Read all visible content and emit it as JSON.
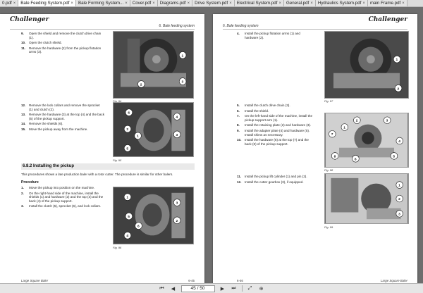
{
  "tabs": [
    {
      "label": "0.pdf",
      "active": false
    },
    {
      "label": "Bale Feeding System.pdf",
      "active": true
    },
    {
      "label": "Bale Forming System...",
      "active": false
    },
    {
      "label": "Cover.pdf",
      "active": false
    },
    {
      "label": "Diagrams.pdf",
      "active": false
    },
    {
      "label": "Drive System.pdf",
      "active": false
    },
    {
      "label": "Electrical System.pdf",
      "active": false
    },
    {
      "label": "General.pdf",
      "active": false
    },
    {
      "label": "Hydraulics System.pdf",
      "active": false
    },
    {
      "label": "main Frame.pdf",
      "active": false
    }
  ],
  "left_page": {
    "brand": "Challenger",
    "section": "6. Bale feeding system",
    "steps_top": [
      {
        "num": "9.",
        "text": "Open the shield and remove the clutch drive chain (1)."
      },
      {
        "num": "10.",
        "text": "Open the clutch shield."
      },
      {
        "num": "11.",
        "text": "Remove the hardware (2) from the pickup flotation arms (3)."
      }
    ],
    "fig1_caption": "Fig. 94",
    "steps_mid": [
      {
        "num": "12.",
        "text": "Remove the lock collars and remove the sprocket (1) and clutch (2)."
      },
      {
        "num": "13.",
        "text": "Remove the hardware (3) at the top (4) and the back (5) of the pickup support."
      },
      {
        "num": "14.",
        "text": "Remove the shields (6)."
      },
      {
        "num": "15.",
        "text": "Move the pickup away from the machine."
      }
    ],
    "fig2_caption": "Fig. 95",
    "heading": "6.8.2   Installing the pickup",
    "intro": "This procedures shows a late production baler with a rotor cutter. The procedure is similar for other balers.",
    "procedure_label": "Procedure",
    "steps_bottom": [
      {
        "num": "1.",
        "text": "Move the pickup into position on the machine."
      },
      {
        "num": "2.",
        "text": "On the right-hand side of the machine, install the shields (1) and hardware (2) and the top (3) and the back (4) of the pickup support."
      },
      {
        "num": "3.",
        "text": "Install the clutch (5), sprocket (6), and lock collars."
      }
    ],
    "fig3_caption": "Fig. 96",
    "footer_line1": "Large Square Baler",
    "footer_line2": "796091400",
    "page_number": "6-45"
  },
  "right_page": {
    "brand": "Challenger",
    "section": "6. Bale feeding system",
    "steps_top": [
      {
        "num": "4.",
        "text": "Install the pickup flotation arms (1) and hardware (2)."
      }
    ],
    "fig1_caption": "Fig. 97",
    "steps_mid": [
      {
        "num": "5.",
        "text": "Install the clutch drive chain (3)."
      },
      {
        "num": "6.",
        "text": "Install the shield."
      },
      {
        "num": "7.",
        "text": "On the left-hand side of the machine, install the pickup support arm (1)."
      },
      {
        "num": "8.",
        "text": "Install the retaining plate (2) and hardware (3)."
      },
      {
        "num": "9.",
        "text": "Install the adapter plate (4) and hardware (5). Install shims as necessary."
      },
      {
        "num": "10.",
        "text": "Install the hardware (6) at the top (7) and the back (8) of the pickup support."
      }
    ],
    "fig2_caption": "Fig. 98",
    "steps_bottom": [
      {
        "num": "11.",
        "text": "Install the pickup lift cylinder (1) and pin (2)."
      },
      {
        "num": "12.",
        "text": "Install the cutter gearbox (3), if equipped."
      }
    ],
    "fig3_caption": "Fig. 99",
    "footer_line1": "Large Square Baler",
    "footer_line2": "796091400",
    "page_number": "6-46"
  },
  "navbar": {
    "page_display": "45 / 50",
    "first": "⏮",
    "prev": "◀",
    "next": "▶",
    "last": "⏭",
    "fit": "⤢",
    "zoom": "⊕"
  }
}
